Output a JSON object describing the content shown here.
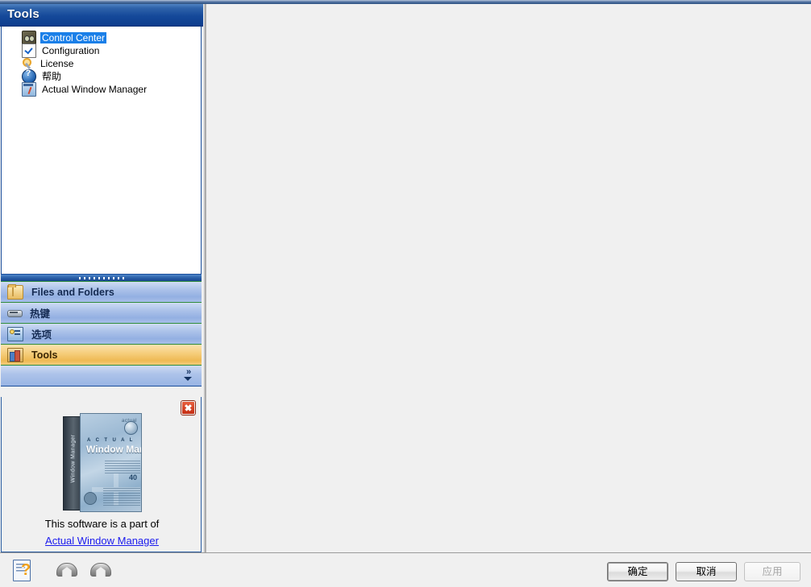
{
  "window": {
    "sidebar_title": "Tools"
  },
  "tree": {
    "items": [
      {
        "label": "Control Center",
        "icon": "control-center-icon",
        "selected": true
      },
      {
        "label": "Configuration",
        "icon": "configuration-icon",
        "selected": false
      },
      {
        "label": "License",
        "icon": "license-key-icon",
        "selected": false
      },
      {
        "label": "帮助",
        "icon": "help-question-icon",
        "selected": false
      },
      {
        "label": "Actual Window Manager",
        "icon": "actual-window-manager-icon",
        "selected": false
      }
    ]
  },
  "nav": {
    "bars": [
      {
        "label": "Files and Folders",
        "icon": "folder-icon",
        "active": false
      },
      {
        "label": "热键",
        "icon": "keyboard-icon",
        "active": false
      },
      {
        "label": "选项",
        "icon": "options-monitor-icon",
        "active": false
      },
      {
        "label": "Tools",
        "icon": "toolbox-icon",
        "active": true
      }
    ],
    "expand_chevron": "»"
  },
  "promo": {
    "close_label": "×",
    "boxshot": {
      "spine_text": "Window Manager",
      "brand_top": "actual",
      "title_small": "A C T U A L",
      "title_big": "Window Manager",
      "badge": "40"
    },
    "caption": "This software is a part of",
    "link": "Actual Window Manager"
  },
  "footer": {
    "help_icon": "help-document-icon",
    "undo_icon": "undo-arrow-icon",
    "redo_icon": "redo-arrow-icon",
    "buttons": {
      "ok": "确定",
      "cancel": "取消",
      "apply": "应用"
    }
  },
  "colors": {
    "header_blue": "#15499a",
    "selection_blue": "#1a7fe8",
    "active_nav_amber": "#eeb953",
    "nav_blue": "#aec4ea",
    "nav_border_green": "#2e8b3a",
    "link_blue": "#1a1aee",
    "close_red": "#c52d12"
  }
}
